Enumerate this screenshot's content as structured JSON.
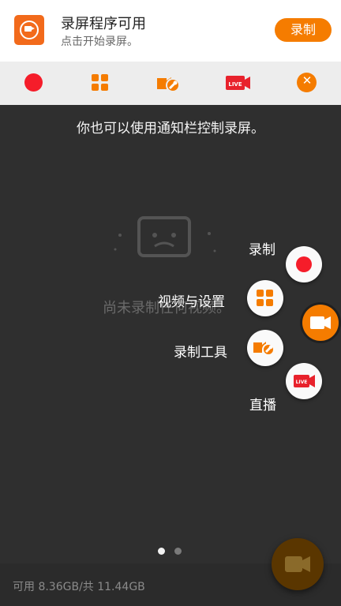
{
  "notification": {
    "title": "录屏程序可用",
    "subtitle": "点击开始录屏。",
    "record_button": "录制"
  },
  "quick_actions": {
    "items": [
      {
        "icon": "record-dot-icon"
      },
      {
        "icon": "grid-icon"
      },
      {
        "icon": "tools-icon"
      },
      {
        "icon": "live-icon",
        "text": "LIVE"
      },
      {
        "icon": "close-icon"
      }
    ]
  },
  "main": {
    "hint": "你也可以使用通知栏控制录屏。",
    "empty_state": "尚未录制任何视频。"
  },
  "floating_menu": {
    "items": [
      {
        "label": "录制",
        "icon": "record-dot-icon"
      },
      {
        "label": "视频与设置",
        "icon": "grid-icon"
      },
      {
        "label": "录制工具",
        "icon": "tools-icon"
      },
      {
        "label": "直播",
        "icon": "live-icon",
        "text": "LIVE"
      }
    ]
  },
  "pager": {
    "pages": 2,
    "current": 1
  },
  "storage": {
    "text": "可用 8.36GB/共 11.44GB"
  },
  "colors": {
    "accent": "#f57c00",
    "record_red": "#f51d2a",
    "background": "#2f2f2f"
  }
}
